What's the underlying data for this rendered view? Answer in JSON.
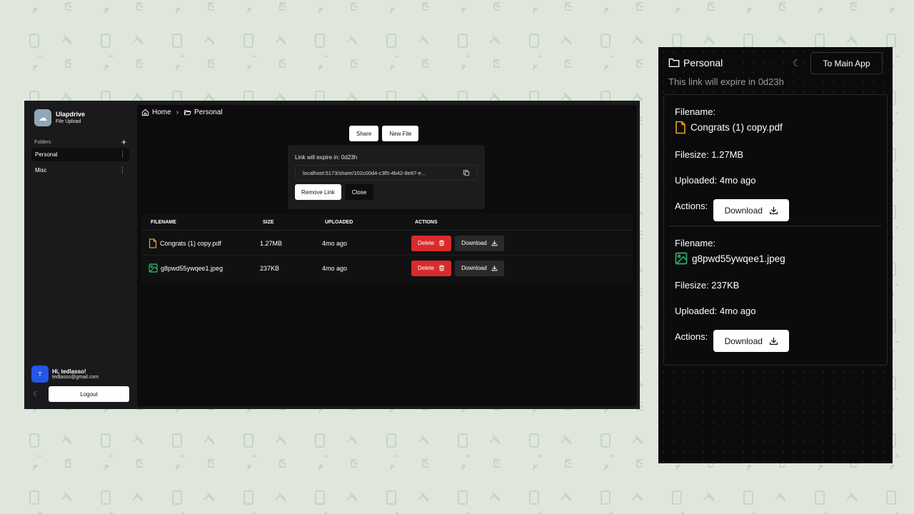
{
  "colors": {
    "accent_purple": "#8b6ff2",
    "danger": "#d92b2b",
    "avatar_blue": "#2456e8",
    "pdf_icon": "#f0a020",
    "image_icon": "#2fb36b"
  },
  "sidebar": {
    "brand": {
      "name": "Ulapdrive",
      "subtitle": "File Upload",
      "icon": "cloud-icon"
    },
    "folders_label": "Folders",
    "folders": [
      {
        "label": "Personal",
        "active": true
      },
      {
        "label": "Misc",
        "active": false
      }
    ],
    "user": {
      "initial": "T",
      "greeting": "Hi, tedlasso!",
      "email": "tedlasso@gmail.com"
    },
    "logout_label": "Logout"
  },
  "breadcrumb": [
    {
      "label": "Home",
      "icon": "home-icon"
    },
    {
      "label": "Personal",
      "icon": "folder-open-icon"
    }
  ],
  "toolbar": {
    "share_label": "Share",
    "new_file_label": "New File"
  },
  "share_popover": {
    "expire_text": "Link will expire in: 0d23h",
    "link": "localhost:5173/share/102c00d4-c3f5-4b42-8e87-e...",
    "remove_label": "Remove Link",
    "close_label": "Close"
  },
  "table": {
    "headers": {
      "filename": "FILENAME",
      "size": "SIZE",
      "uploaded": "UPLOADED",
      "actions": "ACTIONS"
    },
    "rows": [
      {
        "filename": "Congrats (1) copy.pdf",
        "type": "pdf",
        "size": "1.27MB",
        "uploaded": "4mo ago",
        "delete_label": "Delete",
        "download_label": "Download"
      },
      {
        "filename": "g8pwd55ywqee1.jpeg",
        "type": "image",
        "size": "237KB",
        "uploaded": "4mo ago",
        "delete_label": "Delete",
        "download_label": "Download"
      }
    ]
  },
  "share_view": {
    "folder": "Personal",
    "to_main_label": "To Main App",
    "expire_text": "This link will expire in 0d23h",
    "files": [
      {
        "filename_label": "Filename:",
        "filename": "Congrats (1) copy.pdf",
        "type": "pdf",
        "filesize": "Filesize: 1.27MB",
        "uploaded": "Uploaded: 4mo ago",
        "actions_label": "Actions:",
        "download_label": "Download"
      },
      {
        "filename_label": "Filename:",
        "filename": "g8pwd55ywqee1.jpeg",
        "type": "image",
        "filesize": "Filesize: 237KB",
        "uploaded": "Uploaded: 4mo ago",
        "actions_label": "Actions:",
        "download_label": "Download"
      }
    ]
  }
}
